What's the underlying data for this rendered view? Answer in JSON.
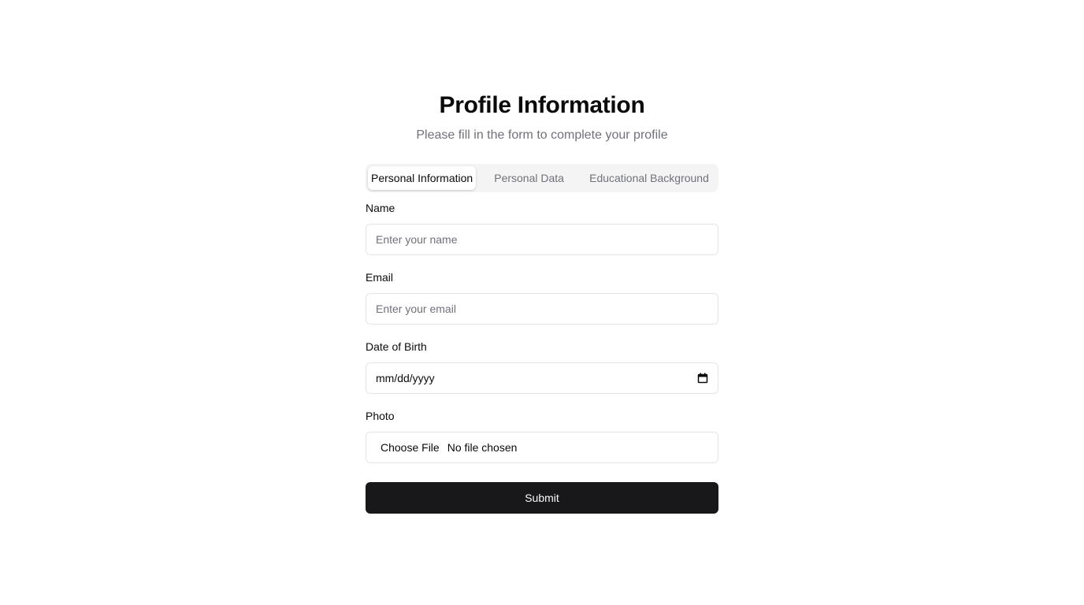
{
  "header": {
    "title": "Profile Information",
    "subtitle": "Please fill in the form to complete your profile"
  },
  "tabs": [
    {
      "label": "Personal Information",
      "active": true
    },
    {
      "label": "Personal Data",
      "active": false
    },
    {
      "label": "Educational Background",
      "active": false
    }
  ],
  "form": {
    "name": {
      "label": "Name",
      "placeholder": "Enter your name",
      "value": ""
    },
    "email": {
      "label": "Email",
      "placeholder": "Enter your email",
      "value": ""
    },
    "dob": {
      "label": "Date of Birth",
      "placeholder": "mm/dd/yyyy",
      "icon": "calendar-icon"
    },
    "photo": {
      "label": "Photo",
      "button_label": "Choose File",
      "status": "No file chosen"
    },
    "submit_label": "Submit"
  },
  "colors": {
    "primary": "#18181b",
    "muted_text": "#71717a",
    "border": "#e4e4e7",
    "tab_bg": "#f4f4f5"
  }
}
